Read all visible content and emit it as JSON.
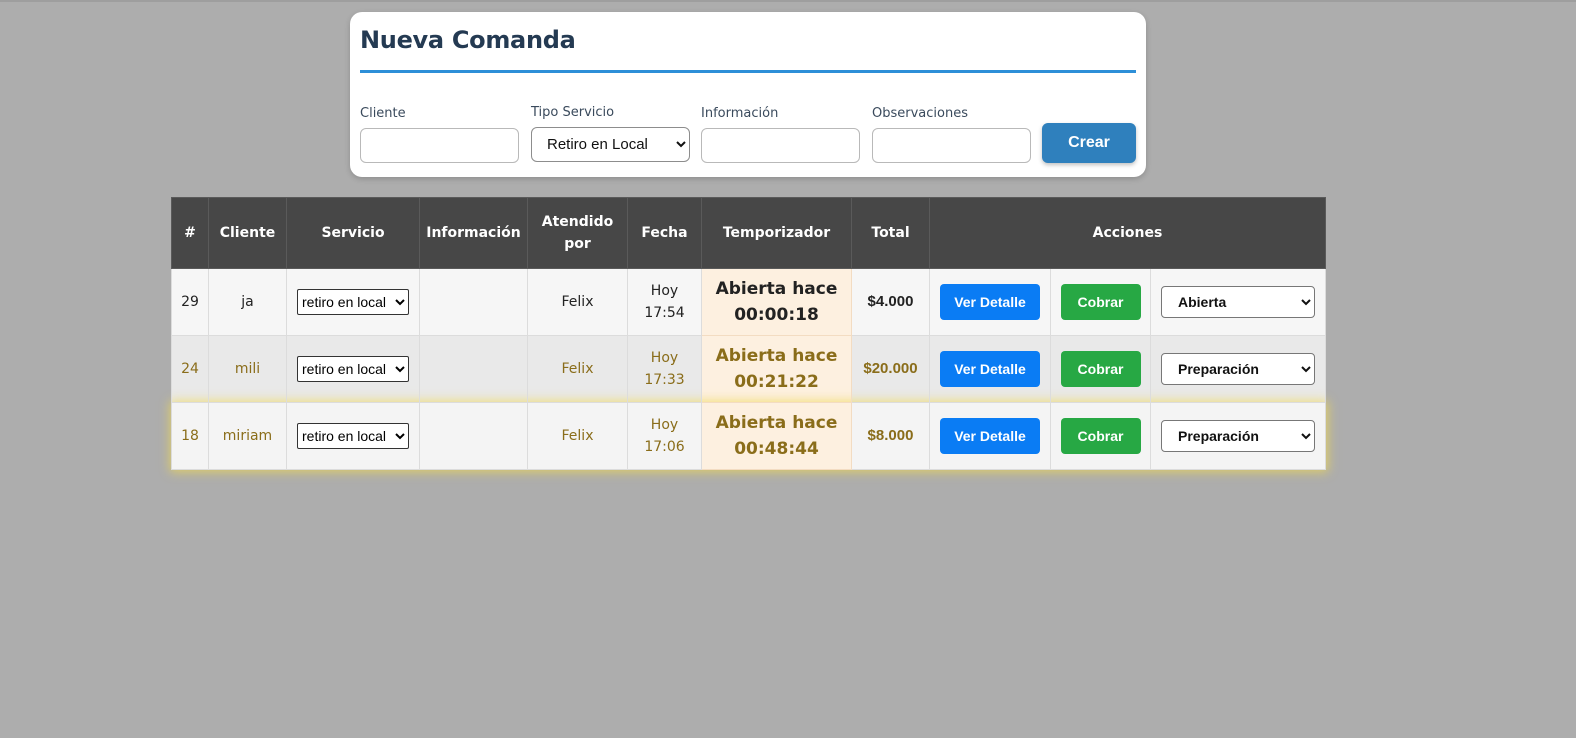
{
  "form": {
    "title": "Nueva Comanda",
    "cliente_label": "Cliente",
    "cliente_value": "",
    "tipo_servicio_label": "Tipo Servicio",
    "tipo_servicio_value": "Retiro en Local",
    "informacion_label": "Información",
    "informacion_value": "",
    "observaciones_label": "Observaciones",
    "observaciones_value": "",
    "crear_label": "Crear"
  },
  "table": {
    "headers": [
      "#",
      "Cliente",
      "Servicio",
      "Información",
      "Atendido por",
      "Fecha",
      "Temporizador",
      "Total",
      "Acciones"
    ],
    "rows": [
      {
        "id": "29",
        "cliente": "ja",
        "servicio": "retiro en local",
        "informacion": "",
        "atendido": "Felix",
        "fecha_dia": "Hoy",
        "fecha_hora": "17:54",
        "timer_label": "Abierta hace",
        "timer_value": "00:00:18",
        "total": "$4.000",
        "ver_label": "Ver Detalle",
        "cobrar_label": "Cobrar",
        "estado": "Abierta"
      },
      {
        "id": "24",
        "cliente": "mili",
        "servicio": "retiro en local",
        "informacion": "",
        "atendido": "Felix",
        "fecha_dia": "Hoy",
        "fecha_hora": "17:33",
        "timer_label": "Abierta hace",
        "timer_value": "00:21:22",
        "total": "$20.000",
        "ver_label": "Ver Detalle",
        "cobrar_label": "Cobrar",
        "estado": "Preparación"
      },
      {
        "id": "18",
        "cliente": "miriam",
        "servicio": "retiro en local",
        "informacion": "",
        "atendido": "Felix",
        "fecha_dia": "Hoy",
        "fecha_hora": "17:06",
        "timer_label": "Abierta hace",
        "timer_value": "00:48:44",
        "total": "$8.000",
        "ver_label": "Ver Detalle",
        "cobrar_label": "Cobrar",
        "estado": "Preparación"
      }
    ]
  },
  "colors": {
    "page_background": "#adadad",
    "header_background": "#474747",
    "accent_blue": "#2d8fd8",
    "button_blue": "#0a7cf4",
    "button_green": "#27a844",
    "timer_text": "#f05a1c",
    "highlight_glow": "#f0d850"
  }
}
